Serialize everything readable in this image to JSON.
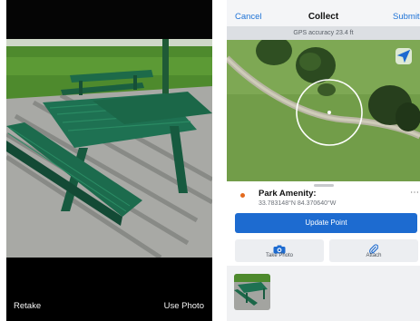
{
  "camera": {
    "retake_label": "Retake",
    "use_photo_label": "Use Photo"
  },
  "collect": {
    "nav": {
      "cancel_label": "Cancel",
      "title": "Collect",
      "submit_label": "Submit"
    },
    "gps_accuracy": "GPS accuracy 23.4 ft",
    "feature": {
      "title": "Park Amenity:",
      "coordinates": "33.783148°N  84.370640°W",
      "point_color": "#e36a1e"
    },
    "update_button_label": "Update Point",
    "take_photo_label": "Take Photo",
    "attach_label": "Attach",
    "accent_color": "#1d6bd0",
    "icons": [
      "locate-arrow-icon",
      "camera-icon",
      "paperclip-icon",
      "more-icon"
    ]
  }
}
